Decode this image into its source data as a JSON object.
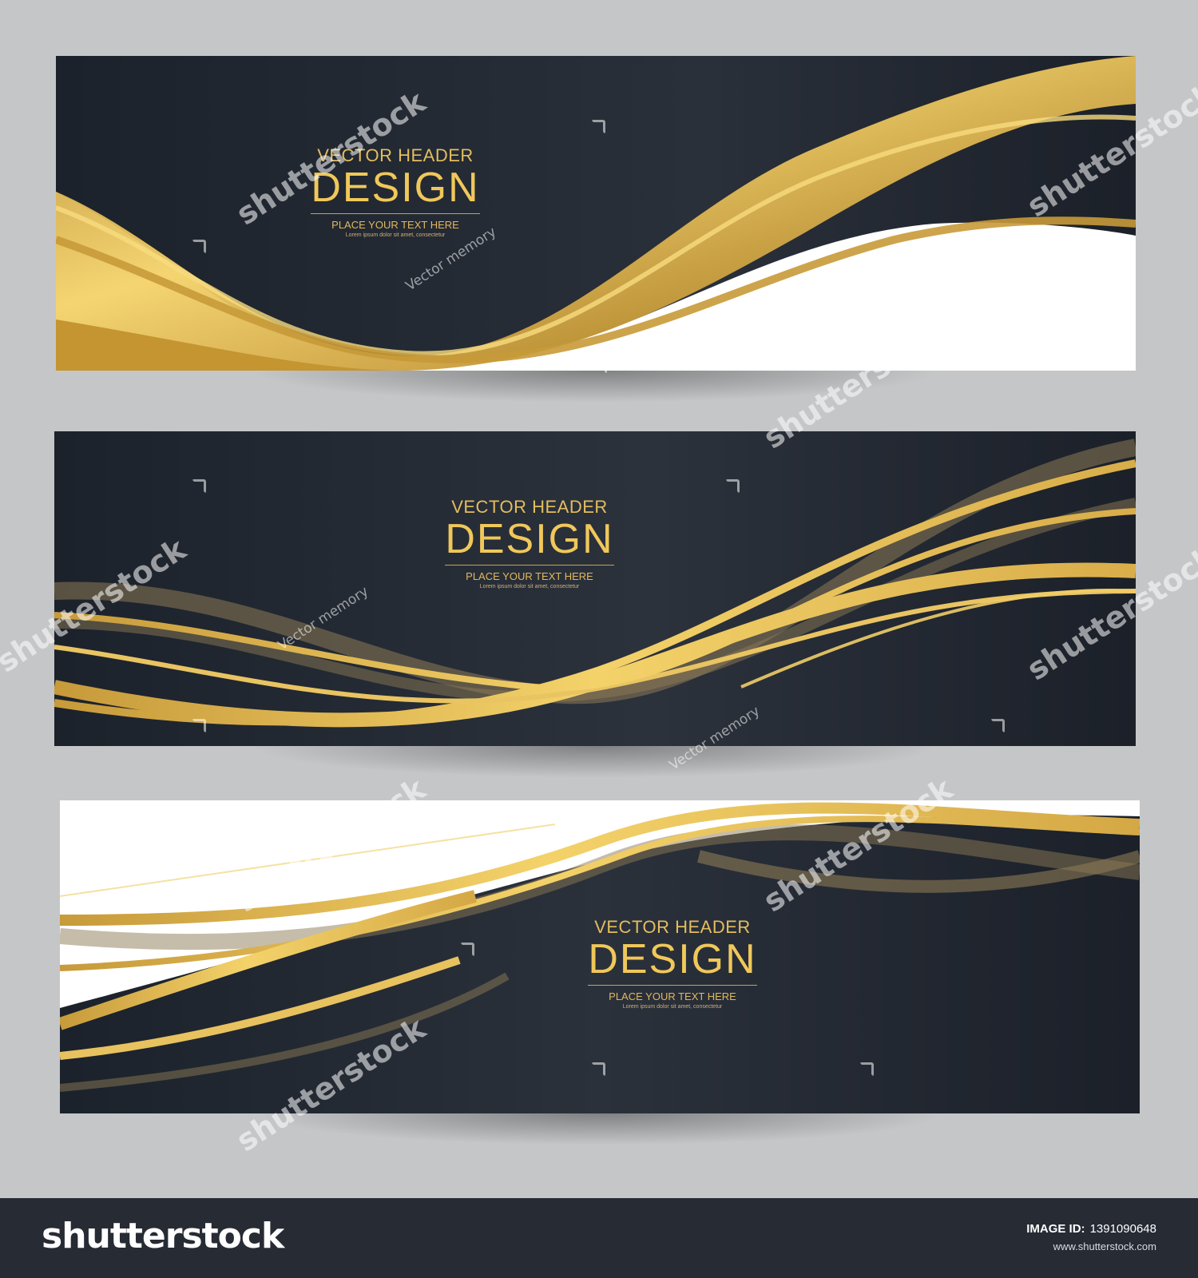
{
  "banners": [
    {
      "pretitle": "VECTOR HEADER",
      "title": "DESIGN",
      "subtitle": "PLACE YOUR TEXT HERE",
      "caption": "Lorem ipsum dolor sit amet, consectetur"
    },
    {
      "pretitle": "VECTOR HEADER",
      "title": "DESIGN",
      "subtitle": "PLACE YOUR TEXT HERE",
      "caption": "Lorem ipsum dolor sit amet, consectetur"
    },
    {
      "pretitle": "VECTOR HEADER",
      "title": "DESIGN",
      "subtitle": "PLACE YOUR TEXT HERE",
      "caption": "Lorem ipsum dolor sit amet, consectetur"
    }
  ],
  "watermarks": {
    "stock": "shutterstock",
    "author": "Vector memory"
  },
  "footer": {
    "logo": "shutterstock",
    "image_id_label": "IMAGE ID:",
    "image_id": "1391090648",
    "site": "www.shutterstock.com"
  },
  "colors": {
    "page_background": "#c5c6c8",
    "banner_dark": "#20262f",
    "gold": "#e3bd5f",
    "footer_background": "#262b34"
  }
}
